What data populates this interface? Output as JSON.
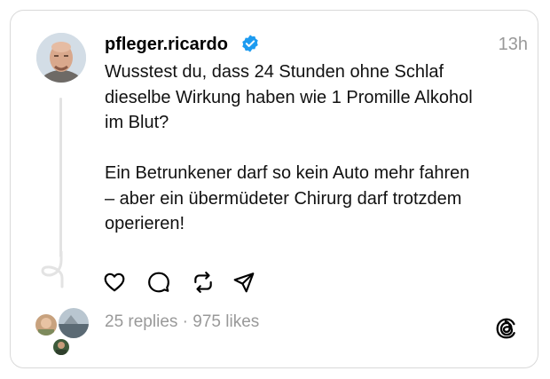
{
  "post": {
    "username": "pfleger.ricardo",
    "verified": true,
    "timestamp": "13h",
    "paragraph_1": [
      "Wusstest du, dass 24 Stunden ohne Schlaf",
      "dieselbe Wirkung haben wie 1 Promille Alkohol",
      "im Blut?"
    ],
    "paragraph_2": [
      "Ein Betrunkener darf so kein Auto mehr fahren",
      "– aber ein übermüdeter Chirurg darf trotzdem",
      "operieren!"
    ]
  },
  "actions": [
    {
      "name": "like",
      "icon": "heart-icon"
    },
    {
      "name": "reply",
      "icon": "comment-icon"
    },
    {
      "name": "repost",
      "icon": "repost-icon"
    },
    {
      "name": "share",
      "icon": "send-icon"
    }
  ],
  "stats": {
    "summary": "25 replies · 975 likes"
  },
  "colors": {
    "verified": "#1d9bf0",
    "muted": "#999999",
    "border": "#d9d9d9"
  }
}
